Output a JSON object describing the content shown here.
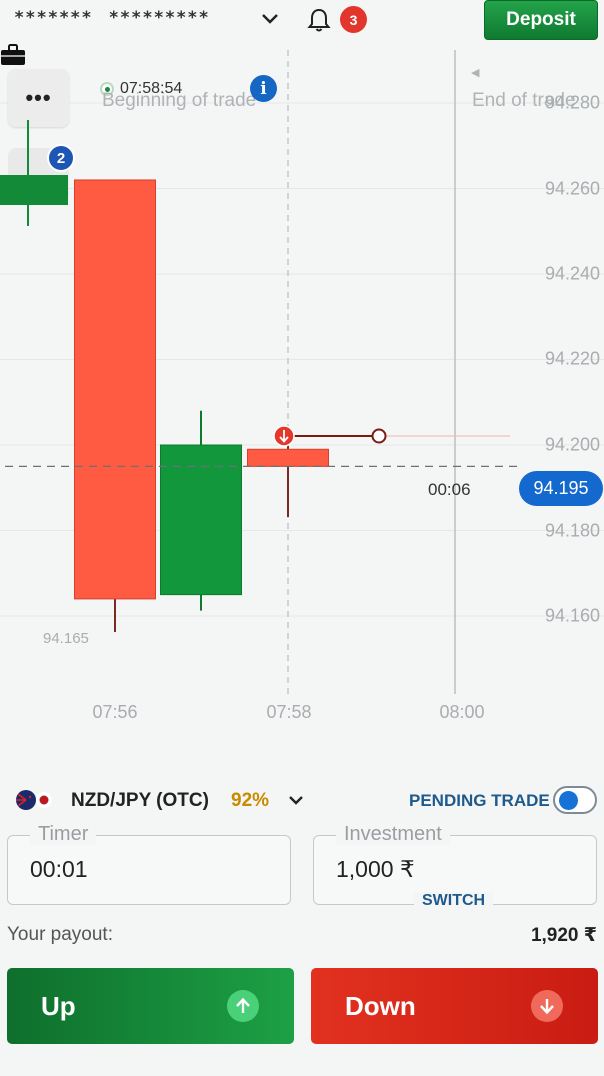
{
  "header": {
    "account_mask_left": "*******",
    "account_mask_right": "*********",
    "notification_count": "3",
    "deposit_label": "Deposit"
  },
  "chart": {
    "time_label": "07:58:54",
    "beginning_label": "Beginning of trade",
    "end_label": "End of trade",
    "open_trades_count": "2",
    "low_label": "94.165",
    "countdown": "00:06",
    "current_price": "94.195",
    "y_ticks": [
      "94.280",
      "94.260",
      "94.240",
      "94.220",
      "94.200",
      "94.180",
      "94.160"
    ],
    "x_ticks": [
      "07:56",
      "07:58",
      "08:00"
    ],
    "colors": {
      "up": "#12973d",
      "down": "#ff5a42",
      "price": "#1469cf"
    }
  },
  "chart_data": {
    "type": "candlestick",
    "x": [
      "07:56",
      "07:57",
      "07:58"
    ],
    "open": [
      94.262,
      94.165,
      94.199
    ],
    "close": [
      94.164,
      94.2,
      94.195
    ],
    "high": [
      94.262,
      94.208,
      94.201
    ],
    "low": [
      94.16,
      94.165,
      94.189
    ],
    "ylim": [
      94.15,
      94.285
    ],
    "current_price": 94.195
  },
  "asset": {
    "name": "NZD/JPY (OTC)",
    "payout_pct": "92%",
    "pending_label": "PENDING TRADE",
    "pending_enabled": true
  },
  "form": {
    "timer_label": "Timer",
    "timer_value": "00:01",
    "investment_label": "Investment",
    "investment_value": "1,000 ₹",
    "switch_label": "SWITCH"
  },
  "payout": {
    "label": "Your payout:",
    "value": "1,920 ₹"
  },
  "actions": {
    "up_label": "Up",
    "down_label": "Down"
  }
}
